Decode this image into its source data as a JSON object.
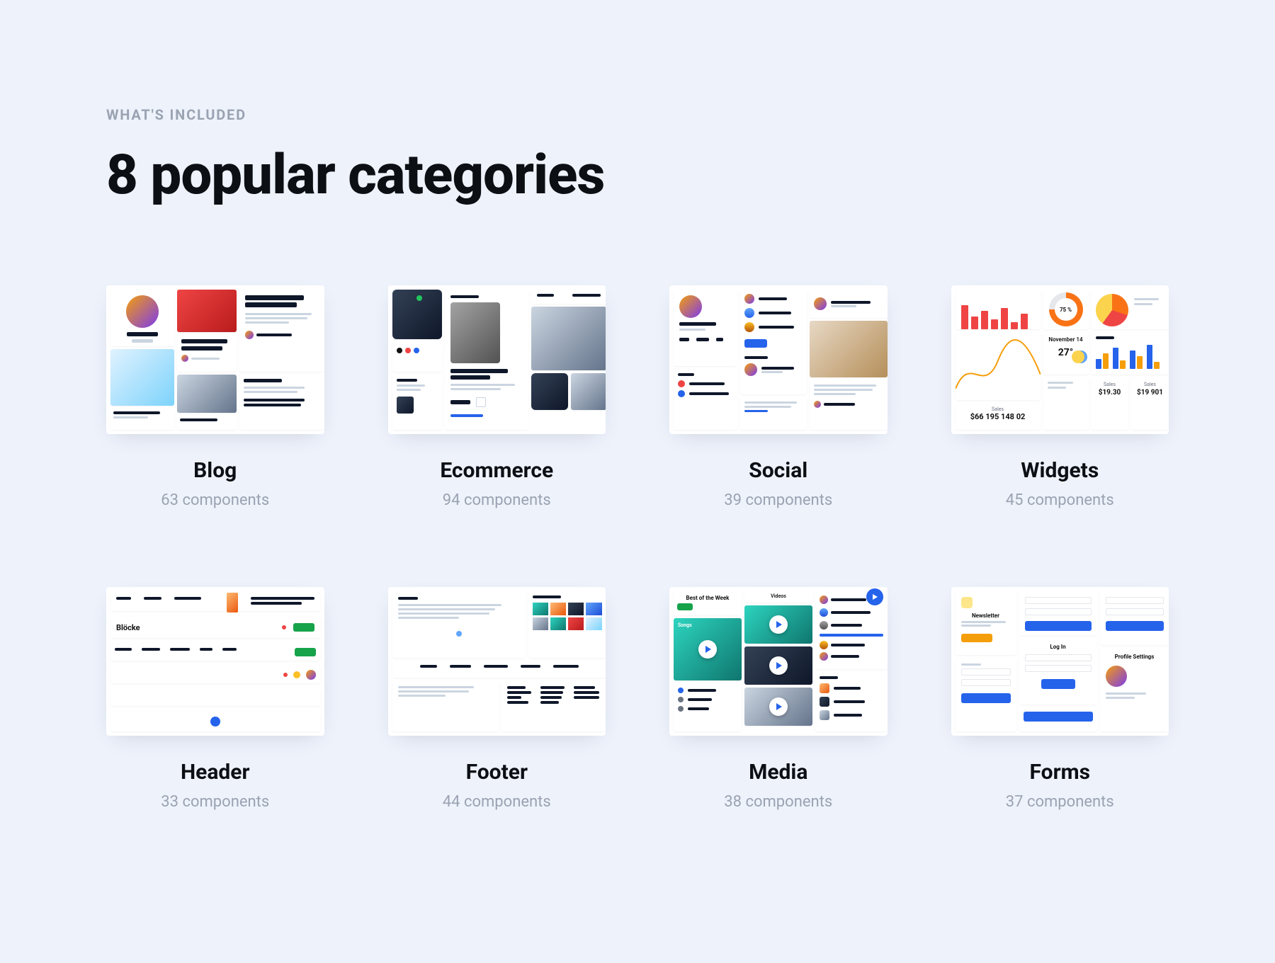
{
  "eyebrow": "WHAT'S INCLUDED",
  "title": "8 popular categories",
  "categories": [
    {
      "name": "Blog",
      "count": "63 components"
    },
    {
      "name": "Ecommerce",
      "count": "94 components"
    },
    {
      "name": "Social",
      "count": "39 components"
    },
    {
      "name": "Widgets",
      "count": "45 components"
    },
    {
      "name": "Header",
      "count": "33 components"
    },
    {
      "name": "Footer",
      "count": "44 components"
    },
    {
      "name": "Media",
      "count": "38 components"
    },
    {
      "name": "Forms",
      "count": "37 components"
    }
  ]
}
